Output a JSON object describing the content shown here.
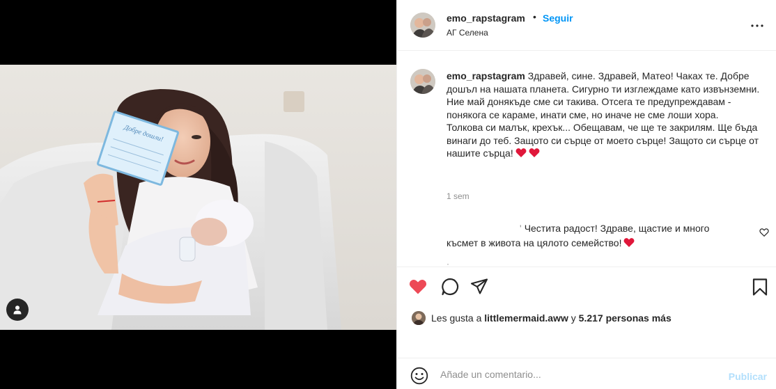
{
  "post": {
    "username": "emo_rapstagram",
    "separator": "•",
    "follow_label": "Seguir",
    "location": "АГ Селена",
    "more_icon": "more-horizontal-icon"
  },
  "caption": {
    "username": "emo_rapstagram",
    "paragraph1": "Здравей, сине. Здравей, Матео! Чаках те. Добре дошъл на нашата планета. Сигурно ти изглеждаме като извънземни. Ние май донякъде сме си такива. Отсега те предупреждавам - понякога се караме, инати сме, но иначе не сме лоши хора.",
    "paragraph2": "Толкова си малък, крехък... Обещавам, че ще те закрилям. Ще бъда винаги до теб. Защото си сърце от моето сърце! Защото си сърце от нашите сърца!",
    "emoji": "heart-emoji",
    "time": "1 sem"
  },
  "comments": [
    {
      "text": "Честита радост! Здраве, щастие и много късмет в живота на цялото семейство!",
      "emoji": "heart-emoji",
      "like_icon": "heart-outline-icon"
    }
  ],
  "actions": {
    "like_icon": "heart-filled-icon",
    "comment_icon": "comment-icon",
    "share_icon": "send-icon",
    "save_icon": "bookmark-icon",
    "liked": true,
    "like_color": "#ed4956"
  },
  "likes": {
    "prefix": "Les gusta a",
    "first_user": "littlemermaid.aww",
    "connector": "y",
    "others": "5.217 personas más"
  },
  "add_comment": {
    "placeholder": "Añade un comentario...",
    "publish_label": "Publicar",
    "emoji_icon": "smiley-icon"
  },
  "media": {
    "user_tag_icon": "user-tag-icon"
  },
  "colors": {
    "link_blue": "#0095f6",
    "publish_disabled": "#b2dffc",
    "secondary_text": "#8e8e8e",
    "border": "#efefef"
  }
}
